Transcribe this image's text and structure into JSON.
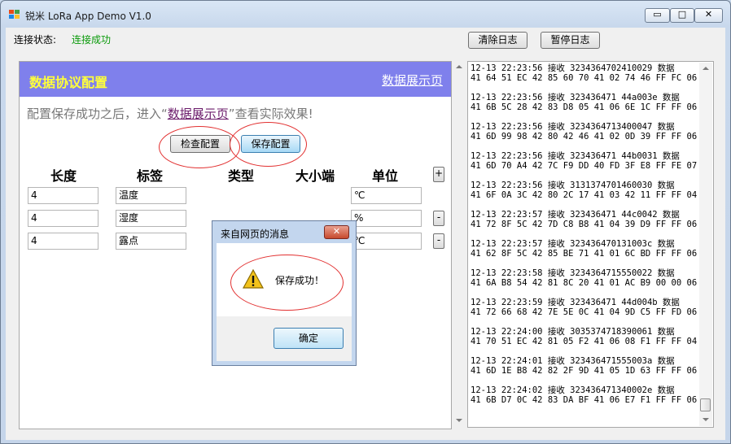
{
  "window": {
    "title": "锐米 LoRa App Demo V1.0",
    "controls": {
      "minimize": "▭",
      "maximize": "□",
      "close": "✕"
    }
  },
  "status": {
    "label": "连接状态:",
    "value": "连接成功",
    "value_color": "#0a9a0a"
  },
  "toolbar": {
    "clear_log": "清除日志",
    "pause_log": "暂停日志"
  },
  "config_page": {
    "banner_title": "数据协议配置",
    "banner_link": "数据展示页",
    "banner_color": "#7f80ec",
    "note_prefix": "配置保存成功之后，进入“",
    "note_link": "数据展示页",
    "note_suffix": "”查看实际效果!",
    "check_button": "检查配置",
    "save_button": "保存配置",
    "headers": {
      "length": "长度",
      "tag": "标签",
      "type": "类型",
      "endian": "大小端",
      "unit": "单位"
    },
    "add_button": "+",
    "remove_button": "-",
    "rows": [
      {
        "length": "4",
        "tag": "温度",
        "unit": "℃"
      },
      {
        "length": "4",
        "tag": "湿度",
        "unit": "%"
      },
      {
        "length": "4",
        "tag": "露点",
        "unit": "℃"
      }
    ]
  },
  "dialog": {
    "title": "来自网页的消息",
    "close": "✕",
    "icon": "warning-icon",
    "message": "保存成功！",
    "ok": "确定"
  },
  "log": {
    "entries": [
      {
        "line1": "12-13 22:23:56 接收 3234364702410029 数据",
        "line2": "41 64 51 EC 42 85 60 70 41 02 74 46 FF FC 06"
      },
      {
        "line1": "12-13 22:23:56 接收 323436471 44a003e 数据",
        "line2": "41 6B 5C 28 42 83 D8 05 41 06 6E 1C FF FF 06"
      },
      {
        "line1": "12-13 22:23:56 接收 3234364713400047 数据",
        "line2": "41 6D 99 98 42 80 42 46 41 02 0D 39 FF FF 06"
      },
      {
        "line1": "12-13 22:23:56 接收 323436471 44b0031 数据",
        "line2": "41 6D 70 A4 42 7C F9 DD 40 FD 3F E8 FF FE 07"
      },
      {
        "line1": "12-13 22:23:56 接收 3131374701460030 数据",
        "line2": "41 6F 0A 3C 42 80 2C 17 41 03 42 11 FF FF 04"
      },
      {
        "line1": "12-13 22:23:57 接收 323436471 44c0042 数据",
        "line2": "41 72 8F 5C 42 7D C8 B8 41 04 39 D9 FF FF 06"
      },
      {
        "line1": "12-13 22:23:57 接收 323436470131003c 数据",
        "line2": "41 62 8F 5C 42 85 BE 71 41 01 6C BD FF FF 06"
      },
      {
        "line1": "12-13 22:23:58 接收 3234364715550022 数据",
        "line2": "41 6A B8 54 42 81 8C 20 41 01 AC B9 00 00 06"
      },
      {
        "line1": "12-13 22:23:59 接收 323436471 44d004b 数据",
        "line2": "41 72 66 68 42 7E 5E 0C 41 04 9D C5 FF FD 06"
      },
      {
        "line1": "12-13 22:24:00 接收 3035374718390061 数据",
        "line2": "41 70 51 EC 42 81 05 F2 41 06 08 F1 FF FF 04"
      },
      {
        "line1": "12-13 22:24:01 接收 323436471555003a 数据",
        "line2": "41 6D 1E B8 42 82 2F 9D 41 05 1D 63 FF FF 06"
      },
      {
        "line1": "12-13 22:24:02 接收 323436471340002e 数据",
        "line2": "41 6B D7 0C 42 83 DA BF 41 06 E7 F1 FF FF 06"
      }
    ]
  }
}
